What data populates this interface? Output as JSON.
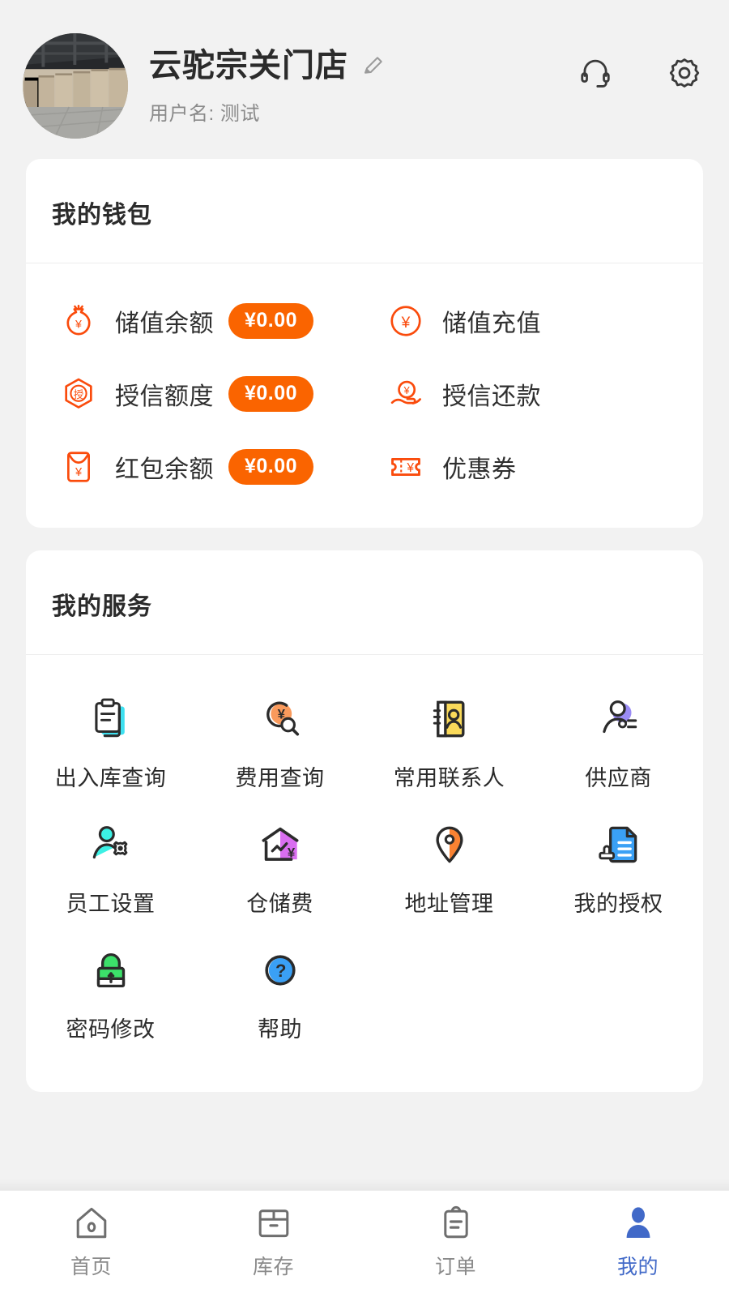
{
  "header": {
    "avatar_icon": "warehouse-photo-avatar",
    "store_name": "云驼宗关门店",
    "edit_icon": "pencil-icon",
    "username_label": "用户名: 测试",
    "support_icon": "headset-icon",
    "settings_icon": "gear-icon"
  },
  "wallet": {
    "title": "我的钱包",
    "accent_color": "#fa6400",
    "left_items": [
      {
        "icon": "money-bag-icon",
        "label": "储值余额",
        "amount": "¥0.00"
      },
      {
        "icon": "credit-hexagon-icon",
        "label": "授信额度",
        "amount": "¥0.00"
      },
      {
        "icon": "red-envelope-icon",
        "label": "红包余额",
        "amount": "¥0.00"
      }
    ],
    "right_items": [
      {
        "icon": "yuan-circle-icon",
        "label": "储值充值"
      },
      {
        "icon": "hand-coin-icon",
        "label": "授信还款"
      },
      {
        "icon": "coupon-ticket-icon",
        "label": "优惠券"
      }
    ]
  },
  "services": {
    "title": "我的服务",
    "items": [
      {
        "icon": "clipboard-search-icon",
        "label": "出入库查询",
        "color": "#3ee0f0"
      },
      {
        "icon": "fee-search-icon",
        "label": "费用查询",
        "color": "#f99a5c"
      },
      {
        "icon": "address-book-icon",
        "label": "常用联系人",
        "color": "#fada5a"
      },
      {
        "icon": "supplier-person-icon",
        "label": "供应商",
        "color": "#9b8cf5"
      },
      {
        "icon": "staff-settings-icon",
        "label": "员工设置",
        "color": "#3cf0e4"
      },
      {
        "icon": "warehouse-fee-icon",
        "label": "仓储费",
        "color": "#d96ef0"
      },
      {
        "icon": "location-pin-icon",
        "label": "地址管理",
        "color": "#f98232"
      },
      {
        "icon": "authorization-doc-icon",
        "label": "我的授权",
        "color": "#3aa0f5"
      },
      {
        "icon": "lock-icon",
        "label": "密码修改",
        "color": "#3ce06a"
      },
      {
        "icon": "help-question-icon",
        "label": "帮助",
        "color": "#3aa0f5"
      }
    ]
  },
  "tabbar": {
    "active_color": "#4169c8",
    "inactive_color": "#8a8a8a",
    "tabs": [
      {
        "icon": "home-icon",
        "label": "首页",
        "active": false
      },
      {
        "icon": "box-icon",
        "label": "库存",
        "active": false
      },
      {
        "icon": "order-clipboard-icon",
        "label": "订单",
        "active": false
      },
      {
        "icon": "person-icon",
        "label": "我的",
        "active": true
      }
    ]
  }
}
